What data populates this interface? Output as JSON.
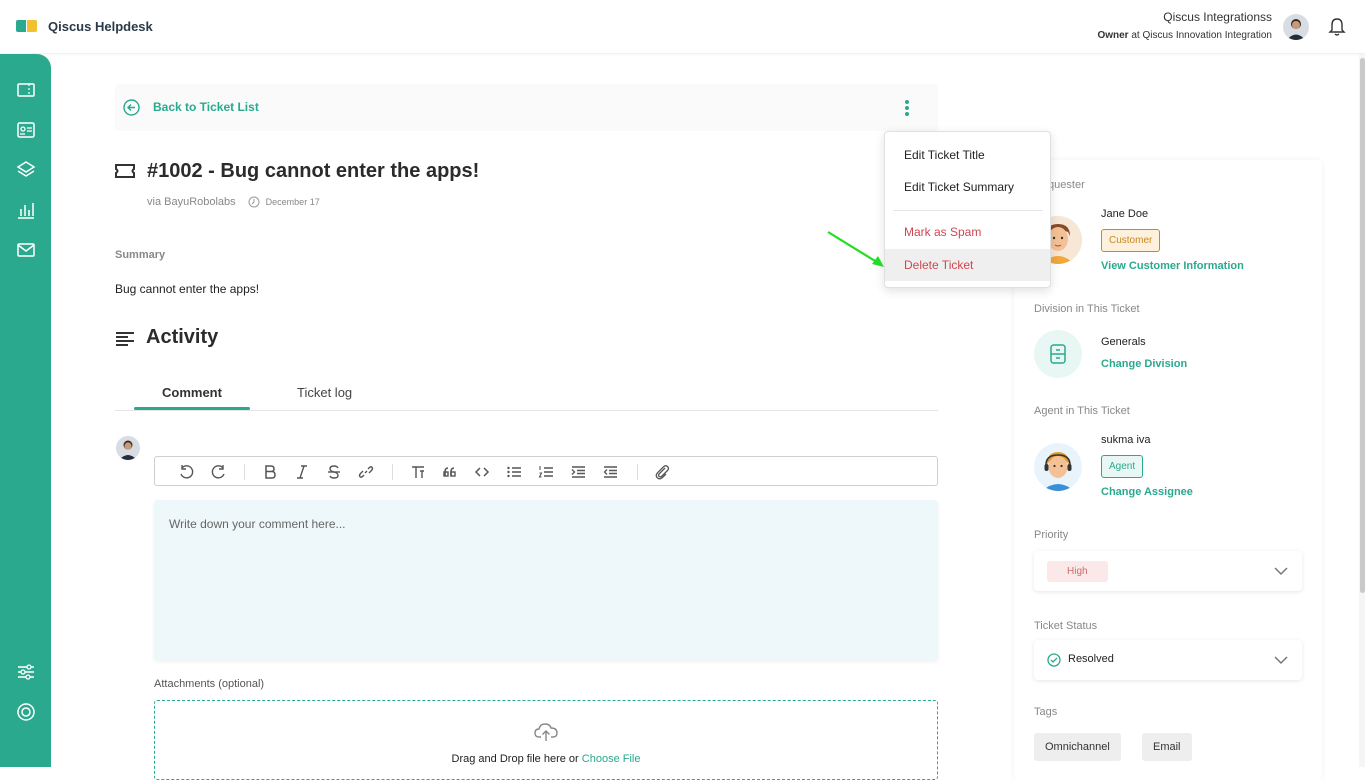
{
  "app": {
    "name": "Qiscus Helpdesk"
  },
  "user": {
    "name": "Qiscus Integrationss",
    "role": "Owner",
    "at_text": " at Qiscus Innovation Integration"
  },
  "back": {
    "label": "Back to Ticket List"
  },
  "ticket": {
    "title": "#1002 - Bug cannot enter the apps!",
    "via": "via BayuRobolabs",
    "date": "December 17"
  },
  "summary": {
    "label": "Summary",
    "text": "Bug cannot enter the apps!"
  },
  "activity": {
    "title": "Activity",
    "tabs": [
      "Comment",
      "Ticket log"
    ]
  },
  "editor": {
    "placeholder": "Write down your comment here..."
  },
  "attachments": {
    "label": "Attachments (optional)",
    "drop_text": "Drag and Drop file here or ",
    "choose_file": "Choose File"
  },
  "menu": {
    "items": [
      "Edit Ticket Title",
      "Edit Ticket Summary",
      "Mark as Spam",
      "Delete Ticket"
    ]
  },
  "requester": {
    "label": "Requester",
    "name": "Jane Doe",
    "badge": "Customer",
    "link": "View Customer Information"
  },
  "division": {
    "label": "Division in This Ticket",
    "name": "Generals",
    "link": "Change Division"
  },
  "agent": {
    "label": "Agent in This Ticket",
    "name": "sukma iva",
    "badge": "Agent",
    "link": "Change Assignee"
  },
  "priority": {
    "label": "Priority",
    "value": "High"
  },
  "status": {
    "label": "Ticket Status",
    "value": "Resolved"
  },
  "tags": {
    "label": "Tags",
    "items": [
      "Omnichannel",
      "Email"
    ]
  },
  "colors": {
    "accent": "#2aa98e",
    "danger": "#d1464f",
    "annotation_arrow": "#22dd22"
  }
}
